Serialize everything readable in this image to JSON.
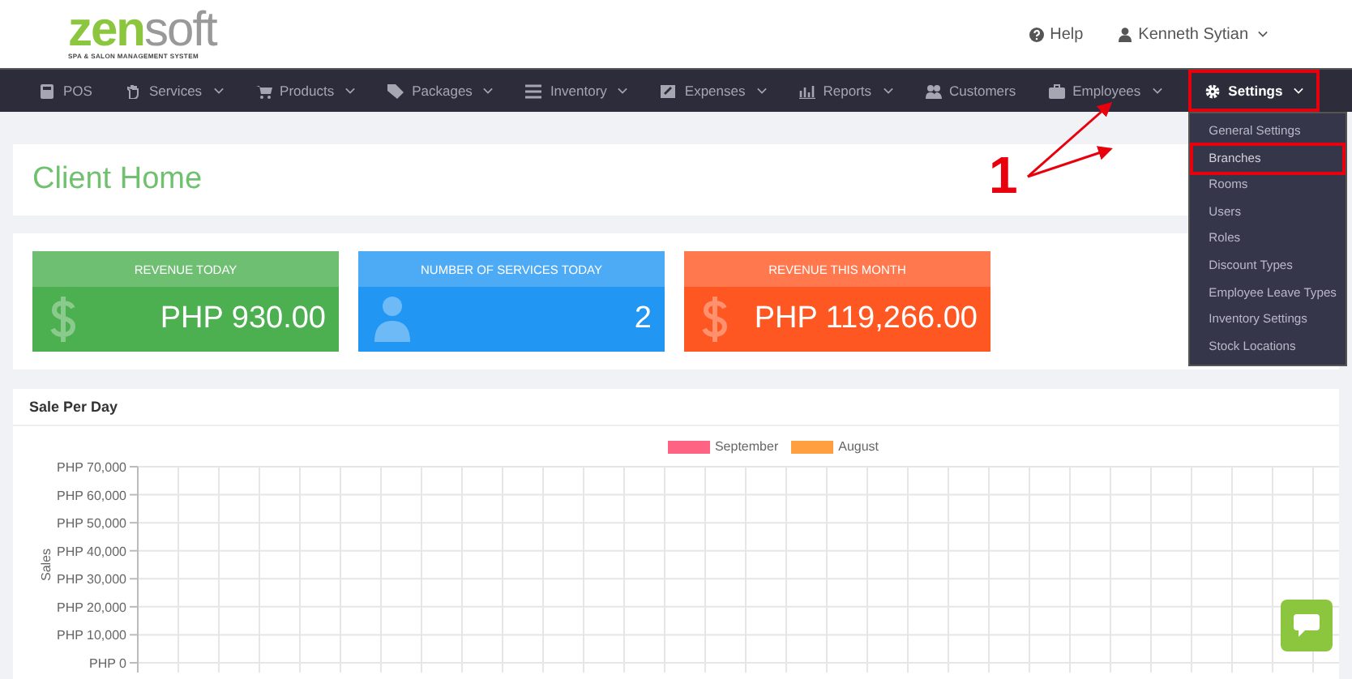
{
  "brand": {
    "logo_main": "zen",
    "logo_rest": "soft",
    "tagline": "SPA & SALON MANAGEMENT SYSTEM"
  },
  "header_links": [
    {
      "kind": "help",
      "label": "Help",
      "caret": false
    },
    {
      "kind": "user",
      "label": "Kenneth Sytian",
      "caret": true
    }
  ],
  "nav": [
    {
      "kind": "calculator",
      "label": "POS",
      "caret": false,
      "selected": false,
      "annotated": false
    },
    {
      "kind": "hand",
      "label": "Services",
      "caret": true,
      "selected": false,
      "annotated": false
    },
    {
      "kind": "cart",
      "label": "Products",
      "caret": true,
      "selected": false,
      "annotated": false
    },
    {
      "kind": "tag",
      "label": "Packages",
      "caret": true,
      "selected": false,
      "annotated": false
    },
    {
      "kind": "list",
      "label": "Inventory",
      "caret": true,
      "selected": false,
      "annotated": false
    },
    {
      "kind": "edit",
      "label": "Expenses",
      "caret": true,
      "selected": false,
      "annotated": false
    },
    {
      "kind": "chart",
      "label": "Reports",
      "caret": true,
      "selected": false,
      "annotated": false
    },
    {
      "kind": "users",
      "label": "Customers",
      "caret": false,
      "selected": false,
      "annotated": false
    },
    {
      "kind": "briefcase",
      "label": "Employees",
      "caret": true,
      "selected": false,
      "annotated": false
    },
    {
      "kind": "gear",
      "label": "Settings",
      "caret": true,
      "selected": true,
      "annotated": true,
      "expanded": true
    }
  ],
  "settings_menu": [
    {
      "label": "General Settings",
      "annotated": false
    },
    {
      "label": "Branches",
      "annotated": true
    },
    {
      "label": "Rooms",
      "annotated": false
    },
    {
      "label": "Users",
      "annotated": false
    },
    {
      "label": "Roles",
      "annotated": false
    },
    {
      "label": "Discount Types",
      "annotated": false
    },
    {
      "label": "Employee Leave Types",
      "annotated": false
    },
    {
      "label": "Inventory Settings",
      "annotated": false
    },
    {
      "label": "Stock Locations",
      "annotated": false
    }
  ],
  "annotation": {
    "label": "1"
  },
  "page_title": "Client Home",
  "stat_cards": [
    {
      "title": "REVENUE TODAY",
      "value": "PHP 930.00",
      "kind": "dollar",
      "color": "#4caf50"
    },
    {
      "title": "NUMBER OF SERVICES TODAY",
      "value": "2",
      "kind": "person",
      "color": "#2196f3"
    },
    {
      "title": "REVENUE THIS MONTH",
      "value": "PHP 119,266.00",
      "kind": "dollar",
      "color": "#ff5722"
    }
  ],
  "sales_panel": {
    "title": "Sale Per Day",
    "axis_title": "Sales",
    "legend": [
      {
        "name": "September",
        "color": "#ff6384"
      },
      {
        "name": "August",
        "color": "#ff9f40"
      }
    ],
    "axis_labels": [
      "PHP 70,000",
      "PHP 60,000",
      "PHP 50,000",
      "PHP 40,000",
      "PHP 30,000",
      "PHP 20,000",
      "PHP 10,000",
      "PHP 0"
    ]
  }
}
